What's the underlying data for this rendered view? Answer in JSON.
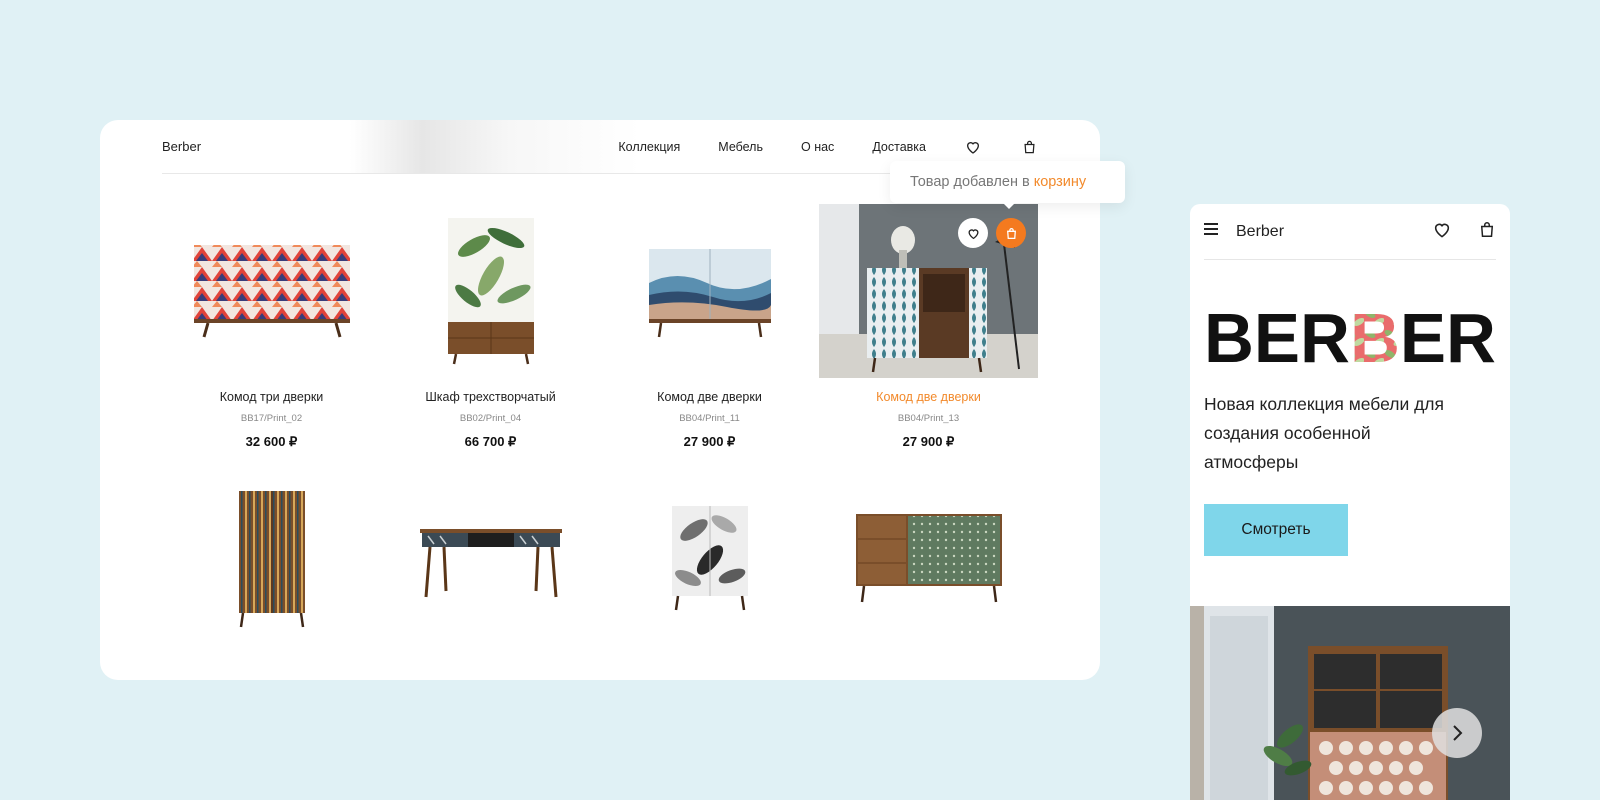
{
  "desktop": {
    "logo": "Berber",
    "nav": [
      "Коллекция",
      "Мебель",
      "О нас",
      "Доставка"
    ],
    "toast": {
      "text": "Товар добавлен в",
      "link": "корзину"
    },
    "products": [
      {
        "name": "Комод три дверки",
        "sku": "BB17/Print_02",
        "price": "32 600 ₽"
      },
      {
        "name": "Шкаф трехстворчатый",
        "sku": "BB02/Print_04",
        "price": "66 700 ₽"
      },
      {
        "name": "Комод две дверки",
        "sku": "BB04/Print_11",
        "price": "27 900 ₽"
      },
      {
        "name": "Комод две дверки",
        "sku": "BB04/Print_13",
        "price": "27 900 ₽"
      }
    ]
  },
  "mobile": {
    "brand": "Berber",
    "big_logo": "BERBER",
    "tagline": "Новая коллекция мебели для создания особенной атмосферы",
    "cta": "Смотреть"
  },
  "colors": {
    "accent": "#f47a1f",
    "cta": "#7fd6ea",
    "background": "#e0f1f5"
  }
}
